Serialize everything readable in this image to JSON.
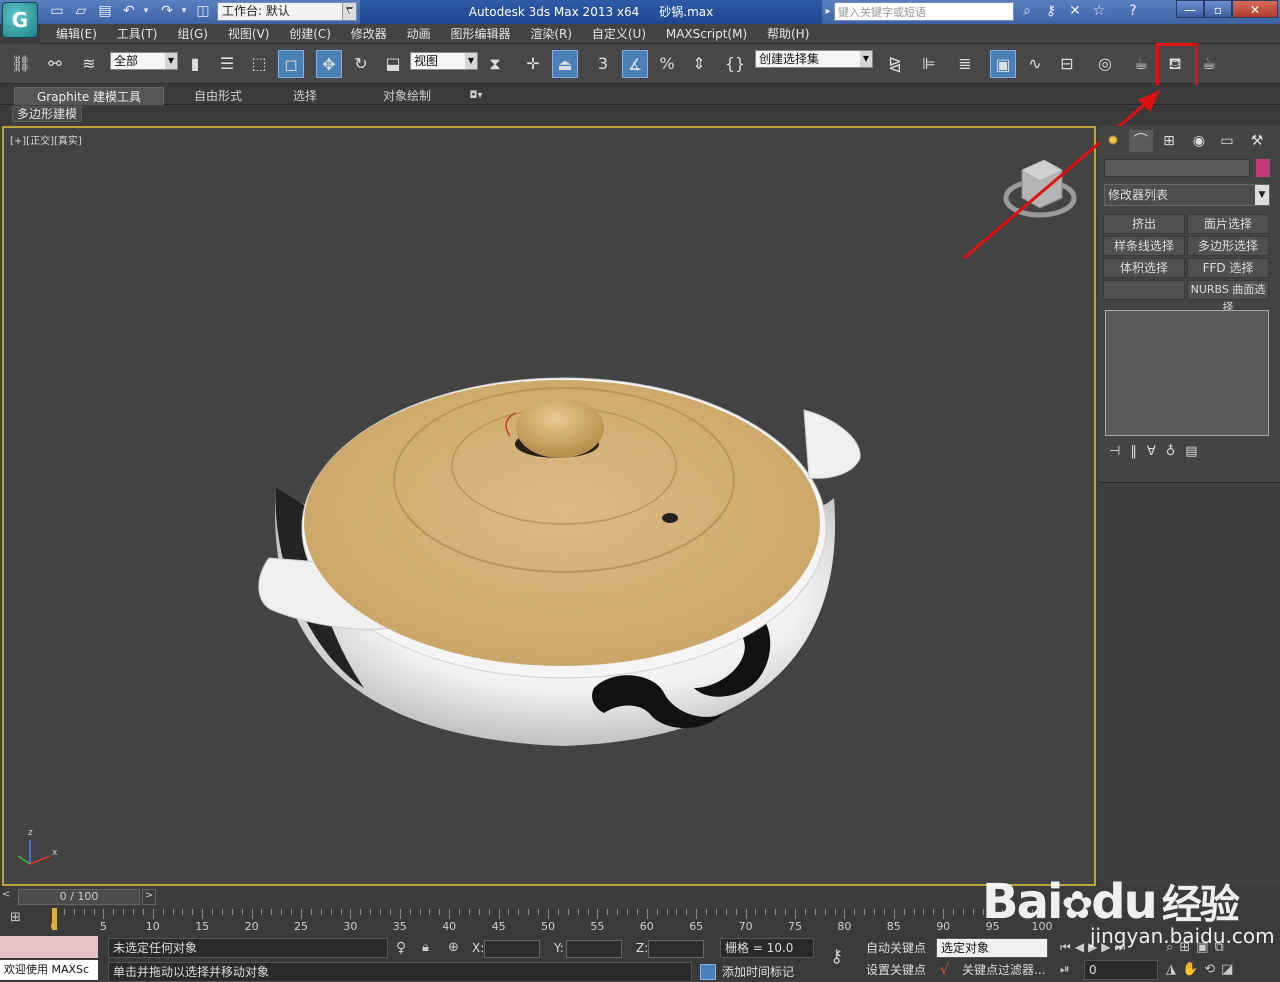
{
  "app": {
    "logo_glyph": "G",
    "workspace_label": "工作台: 默认",
    "title_app": "Autodesk 3ds Max  2013 x64",
    "title_file": "砂锅.max",
    "search_placeholder": "键入关键字或短语"
  },
  "menubar": [
    "编辑(E)",
    "工具(T)",
    "组(G)",
    "视图(V)",
    "创建(C)",
    "修改器",
    "动画",
    "图形编辑器",
    "渲染(R)",
    "自定义(U)",
    "MAXScript(M)",
    "帮助(H)"
  ],
  "toolbar": {
    "selection_filter": "全部",
    "reference_coord": "视图",
    "named_selection": "创建选择集",
    "snap_label": "3",
    "percent_label": "%",
    "highlighted_tool": "render-teapot-icon"
  },
  "ribbon": {
    "tabs": [
      "Graphite 建模工具",
      "自由形式",
      "选择",
      "对象绘制"
    ],
    "sub_tab": "多边形建模"
  },
  "viewport": {
    "label": "[+][正交][真实]",
    "axis_z": "z",
    "axis_x": "x"
  },
  "command_panel": {
    "modifier_list": "修改器列表",
    "buttons": [
      "挤出",
      "面片选择",
      "样条线选择",
      "多边形选择",
      "体积选择",
      "FFD 选择",
      "",
      "NURBS 曲面选择"
    ]
  },
  "timeline": {
    "slider_label": "0 / 100",
    "ticks": [
      "0",
      "5",
      "10",
      "15",
      "20",
      "25",
      "30",
      "35",
      "40",
      "45",
      "50",
      "55",
      "60",
      "65",
      "70",
      "75",
      "80",
      "85",
      "90",
      "95",
      "100"
    ]
  },
  "status": {
    "listener": "欢迎使用 MAXSc",
    "selection_text": "未选定任何对象",
    "prompt_text": "单击并拖动以选择并移动对象",
    "x_label": "X:",
    "y_label": "Y:",
    "z_label": "Z:",
    "grid_text": "栅格 = 10.0",
    "auto_key": "自动关键点",
    "set_key": "设置关键点",
    "key_target": "选定对象",
    "key_filter": "关键点过滤器...",
    "add_time_tag": "添加时间标记",
    "frame_value": "0"
  },
  "watermark": {
    "brand": "Bai",
    "brand2": "du",
    "cn": "经验",
    "url": "jingyan.baidu.com"
  },
  "colors": {
    "accent": "#4b7fb8",
    "highlight_box": "#e01010",
    "viewport_border": "#bfa23a"
  }
}
